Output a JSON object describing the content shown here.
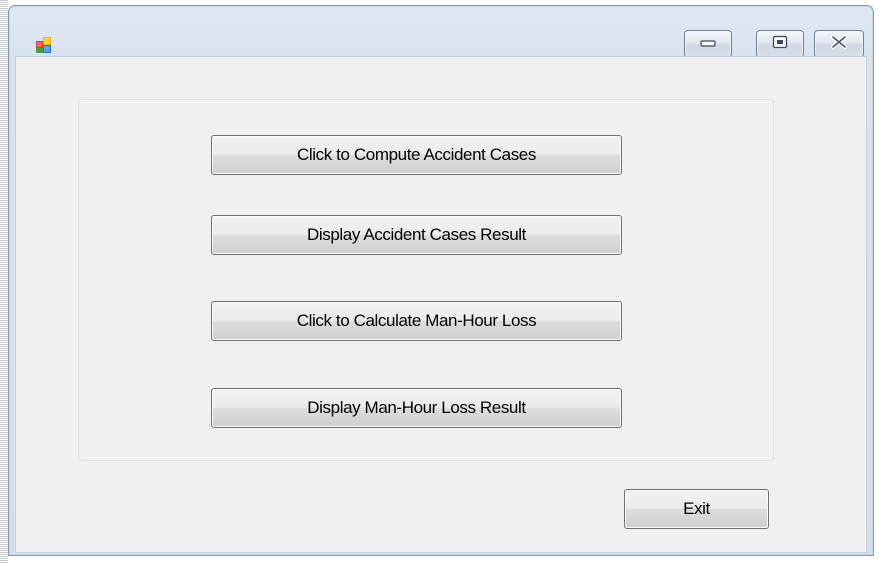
{
  "window": {
    "title": "",
    "icon": "app-window-icon"
  },
  "title_bar": {
    "minimize_icon": "minimize-icon",
    "maximize_icon": "maximize-icon",
    "close_icon": "close-icon"
  },
  "main": {
    "buttons": [
      {
        "label": "Click to Compute Accident Cases"
      },
      {
        "label": "Display Accident Cases Result"
      },
      {
        "label": "Click to Calculate Man-Hour Loss"
      },
      {
        "label": "Display Man-Hour Loss Result"
      }
    ],
    "exit_label": "Exit"
  },
  "colors": {
    "frame": "#d8e3f0",
    "client_background": "#f0f0f0",
    "button_border": "#707070"
  }
}
